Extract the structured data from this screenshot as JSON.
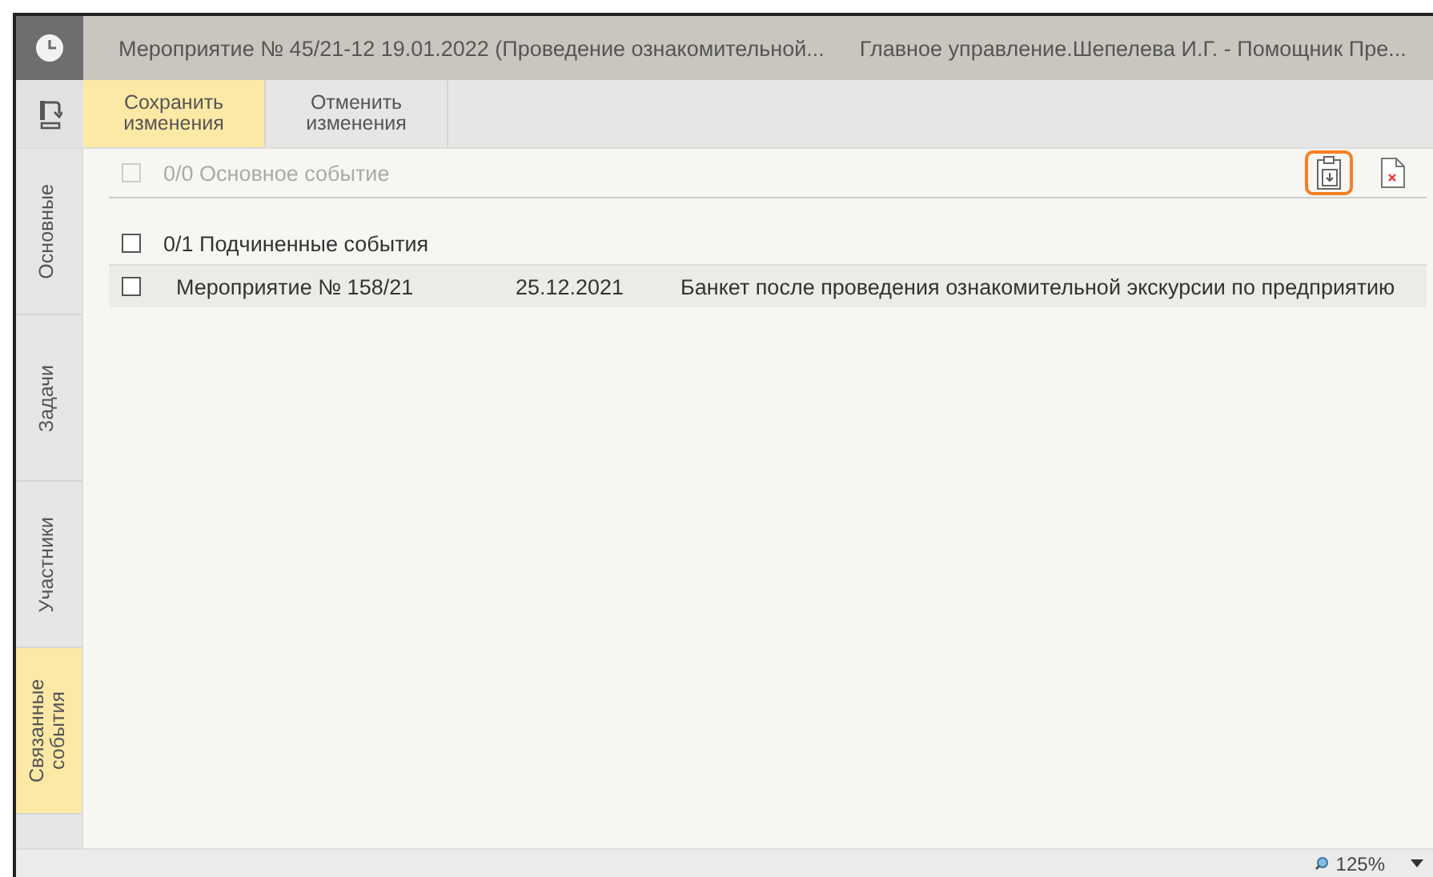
{
  "header": {
    "title": "Мероприятие № 45/21-12 19.01.2022 (Проведение ознакомительной...",
    "user": "Главное управление.Шепелева И.Г. - Помощник Пре..."
  },
  "toolbar": {
    "buttons": [
      {
        "label": "Сохранить изменения",
        "selected": true
      },
      {
        "label": "Отменить изменения",
        "selected": false
      }
    ]
  },
  "side_tabs": [
    {
      "label": "Основные",
      "selected": false
    },
    {
      "label": "Задачи",
      "selected": false
    },
    {
      "label": "Участники",
      "selected": false
    },
    {
      "label": "Связанные события",
      "selected": true
    }
  ],
  "main_event": {
    "label": "0/0 Основное событие",
    "checked": false,
    "disabled": true
  },
  "actions": [
    {
      "kind": "paste",
      "highlighted": true
    },
    {
      "kind": "delete",
      "highlighted": false
    }
  ],
  "sub_events": {
    "label": "0/1 Подчиненные события",
    "checked": false,
    "rows": [
      {
        "name": "Мероприятие № 158/21",
        "date": "25.12.2021",
        "description": "Банкет после проведения ознакомительной экскурсии по предприятию",
        "checked": false
      }
    ]
  },
  "status_bar": {
    "zoom": "125%"
  }
}
